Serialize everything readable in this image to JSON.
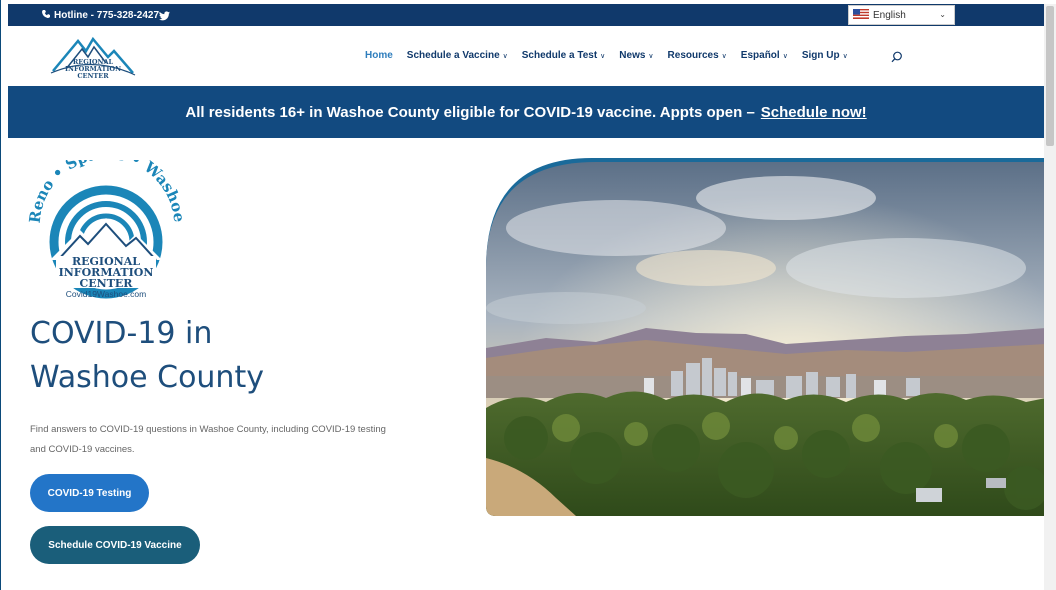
{
  "topbar": {
    "hotline": "Hotline - 775-328-2427",
    "language": "English"
  },
  "logo": {
    "small_lines": [
      "REGIONAL",
      "INFORMATION",
      "CENTER"
    ]
  },
  "nav": {
    "items": [
      {
        "label": "Home",
        "caret": false
      },
      {
        "label": "Schedule a Vaccine",
        "caret": true
      },
      {
        "label": "Schedule a Test",
        "caret": true
      },
      {
        "label": "News",
        "caret": true
      },
      {
        "label": "Resources",
        "caret": true
      },
      {
        "label": "Español",
        "caret": true
      },
      {
        "label": "Sign Up",
        "caret": true
      }
    ]
  },
  "banner": {
    "text": "All residents 16+ in Washoe County eligible for COVID-19 vaccine. Appts open –",
    "link": "Schedule now!"
  },
  "hero": {
    "logo_arc_text": "Reno • Sparks • Washoe",
    "logo_lines": [
      "REGIONAL",
      "INFORMATION",
      "CENTER"
    ],
    "logo_url": "Covid19Washoe.com",
    "title_line1": "COVID-19 in",
    "title_line2": "Washoe County",
    "description": "Find answers to COVID-19 questions in Washoe County, including COVID-19 testing and COVID-19 vaccines.",
    "button_testing": "COVID-19 Testing",
    "button_vaccine": "Schedule COVID-19 Vaccine"
  },
  "colors": {
    "topbar": "#10396b",
    "banner": "#124a80",
    "nav_text": "#10396b",
    "nav_active": "#2f7ebd",
    "button_testing": "#2375c8",
    "button_vaccine": "#1a5e7a",
    "logo_blue": "#1b86b8"
  }
}
